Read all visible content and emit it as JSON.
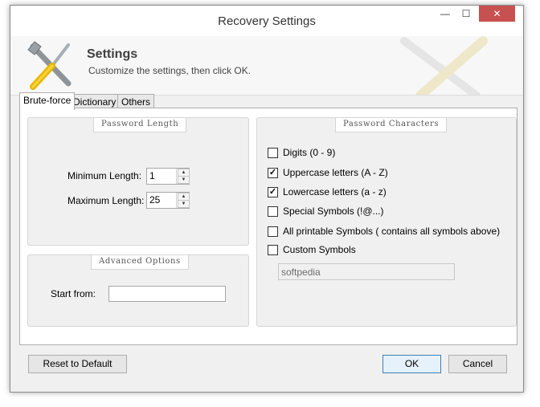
{
  "window": {
    "title": "Recovery Settings",
    "minimize_glyph": "—",
    "maximize_glyph": "☐",
    "close_glyph": "✕"
  },
  "header": {
    "title": "Settings",
    "subtitle": "Customize the settings, then click OK.",
    "icon": "wrench-screwdriver-icon"
  },
  "tabs": [
    {
      "label": "Brute-force",
      "active": true
    },
    {
      "label": "Dictionary",
      "active": false
    },
    {
      "label": "Others",
      "active": false
    }
  ],
  "password_length": {
    "title": "Password Length",
    "min_label": "Minimum Length:",
    "min_value": "1",
    "max_label": "Maximum Length:",
    "max_value": "25"
  },
  "advanced": {
    "title": "Advanced Options",
    "start_label": "Start from:",
    "start_value": ""
  },
  "characters": {
    "title": "Password Characters",
    "options": [
      {
        "label": "Digits (0 - 9)",
        "checked": false
      },
      {
        "label": "Uppercase letters (A - Z)",
        "checked": true
      },
      {
        "label": "Lowercase letters (a - z)",
        "checked": true
      },
      {
        "label": "Special Symbols (!@...)",
        "checked": false
      },
      {
        "label": "All printable Symbols ( contains all symbols above)",
        "checked": false
      },
      {
        "label": "Custom Symbols",
        "checked": false
      }
    ],
    "custom_value": "softpedia"
  },
  "footer": {
    "reset_label": "Reset to Default",
    "ok_label": "OK",
    "cancel_label": "Cancel"
  },
  "colors": {
    "close_button": "#c75050",
    "ok_border": "#3c7fb1",
    "window_bg": "#f0f0f0"
  }
}
